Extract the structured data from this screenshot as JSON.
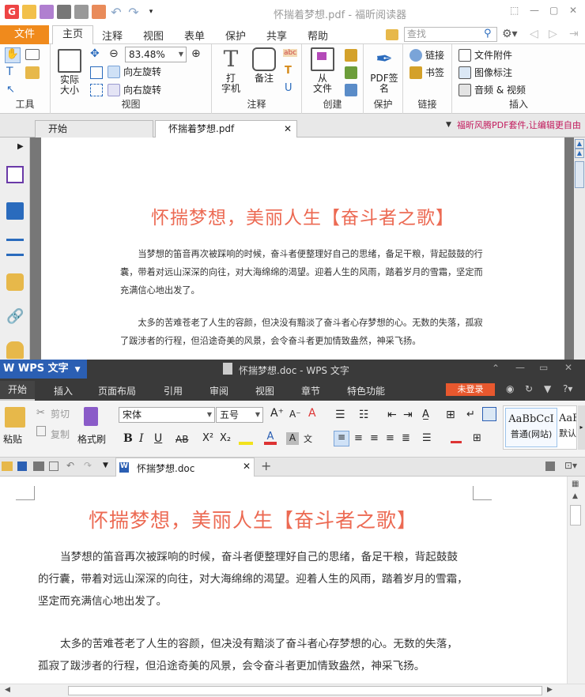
{
  "foxit": {
    "window_title": "怀揣着梦想.pdf - 福昕阅读器",
    "menu_file": "文件",
    "tabs": [
      "主页",
      "注释",
      "视图",
      "表单",
      "保护",
      "共享",
      "帮助"
    ],
    "search_placeholder": "查找",
    "ribbon": {
      "tools_label": "工具",
      "view_label": "视图",
      "actual_size": "实际\n大小",
      "zoom_value": "83.48%",
      "rotate_left": "向左旋转",
      "rotate_right": "向右旋转",
      "comment_label": "注释",
      "typewriter": "打\n字机",
      "note": "备注",
      "create_label": "创建",
      "from_file": "从\n文件",
      "protect_label": "保护",
      "pdf_sign": "PDF签\n名",
      "link_label": "链接",
      "link": "链接",
      "bookmark": "书签",
      "insert_label": "插入",
      "file_attachment": "文件附件",
      "image_annotation": "图像标注",
      "audio_video": "音频 & 视频",
      "abc": "abc"
    },
    "doc_tabs": [
      "开始",
      "怀揣着梦想.pdf"
    ],
    "promo": "福昕风腾PDF套件,让编辑更自由",
    "doc_title": "怀揣梦想，美丽人生【奋斗者之歌】",
    "para1": "当梦想的笛音再次被踩响的时候，奋斗者便整理好自己的思绪，备足干粮，背起鼓鼓的行囊，带着对远山深深的向往，对大海绵绵的渴望。迎着人生的风雨，踏着岁月的雪霜，坚定而充满信心地出发了。",
    "para2": "太多的苦难苍老了人生的容颜，但决没有黯淡了奋斗者心存梦想的心。无数的失落，孤寂了跋涉者的行程，但沿途奇美的风景，会令奋斗者更加情致盎然，神采飞扬。"
  },
  "wps": {
    "app_name": "WPS 文字",
    "window_title": "怀揣梦想.doc - WPS 文字",
    "tabs": [
      "开始",
      "插入",
      "页面布局",
      "引用",
      "审阅",
      "视图",
      "章节",
      "特色功能"
    ],
    "login": "未登录",
    "clipboard": {
      "paste": "粘贴",
      "cut": "剪切",
      "copy": "复制",
      "format_painter": "格式刷"
    },
    "font_name": "宋体",
    "font_size": "五号",
    "styles": [
      {
        "sample": "AaBbCcI",
        "name": "普通(网站)"
      },
      {
        "sample": "AaE",
        "name": "默认"
      }
    ],
    "doc_tab": "怀揣梦想.doc",
    "doc_title": "怀揣梦想，美丽人生【奋斗者之歌】",
    "para1_line1": "当梦想的笛音再次被踩响的时候，奋斗者便整理好自己的思绪，备足干粮，背起鼓鼓",
    "para1_line2": "的行囊，带着对远山深深的向往，对大海绵绵的渴望。迎着人生的风雨，踏着岁月的雪霜，",
    "para1_line3": "坚定而充满信心地出发了。",
    "para2_line1": "太多的苦难苍老了人生的容颜，但决没有黯淡了奋斗者心存梦想的心。无数的失落，",
    "para2_line2": "孤寂了跋涉者的行程，但沿途奇美的风景，会令奋斗者更加情致盎然，神采飞扬。",
    "bold": "B",
    "italic": "I",
    "underline": "U",
    "strike": "AB"
  },
  "colors": {
    "foxit_orange": "#f08a1c",
    "title_red": "#ec6a53",
    "wps_blue": "#2b5fb3",
    "wps_login": "#e8582e"
  }
}
